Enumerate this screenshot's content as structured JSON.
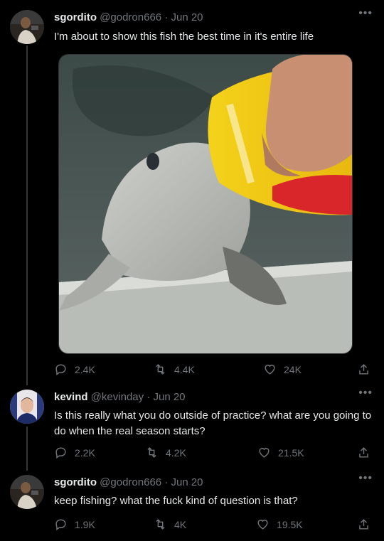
{
  "tweets": [
    {
      "name": "sgordito",
      "handle": "@godron666",
      "date": "Jun 20",
      "text": "I'm about to show this fish the best time in it's entire life",
      "replies": "2.4K",
      "retweets": "4.4K",
      "likes": "24K"
    },
    {
      "name": "kevind",
      "handle": "@kevinday",
      "date": "Jun 20",
      "text": "Is this really what you do outside of practice? what are you going to do when the real season starts?",
      "replies": "2.2K",
      "retweets": "4.2K",
      "likes": "21.5K"
    },
    {
      "name": "sgordito",
      "handle": "@godron666",
      "date": "Jun 20",
      "text": "keep fishing? what the fuck kind of question is that?",
      "replies": "1.9K",
      "retweets": "4K",
      "likes": "19.5K"
    }
  ],
  "separator": "·",
  "icons": {
    "reply": "reply-icon",
    "retweet": "retweet-icon",
    "like": "heart-icon",
    "share": "share-icon",
    "more": "more-icon"
  },
  "colors": {
    "background": "#000000",
    "text": "#e7e9ea",
    "muted": "#71767b"
  }
}
